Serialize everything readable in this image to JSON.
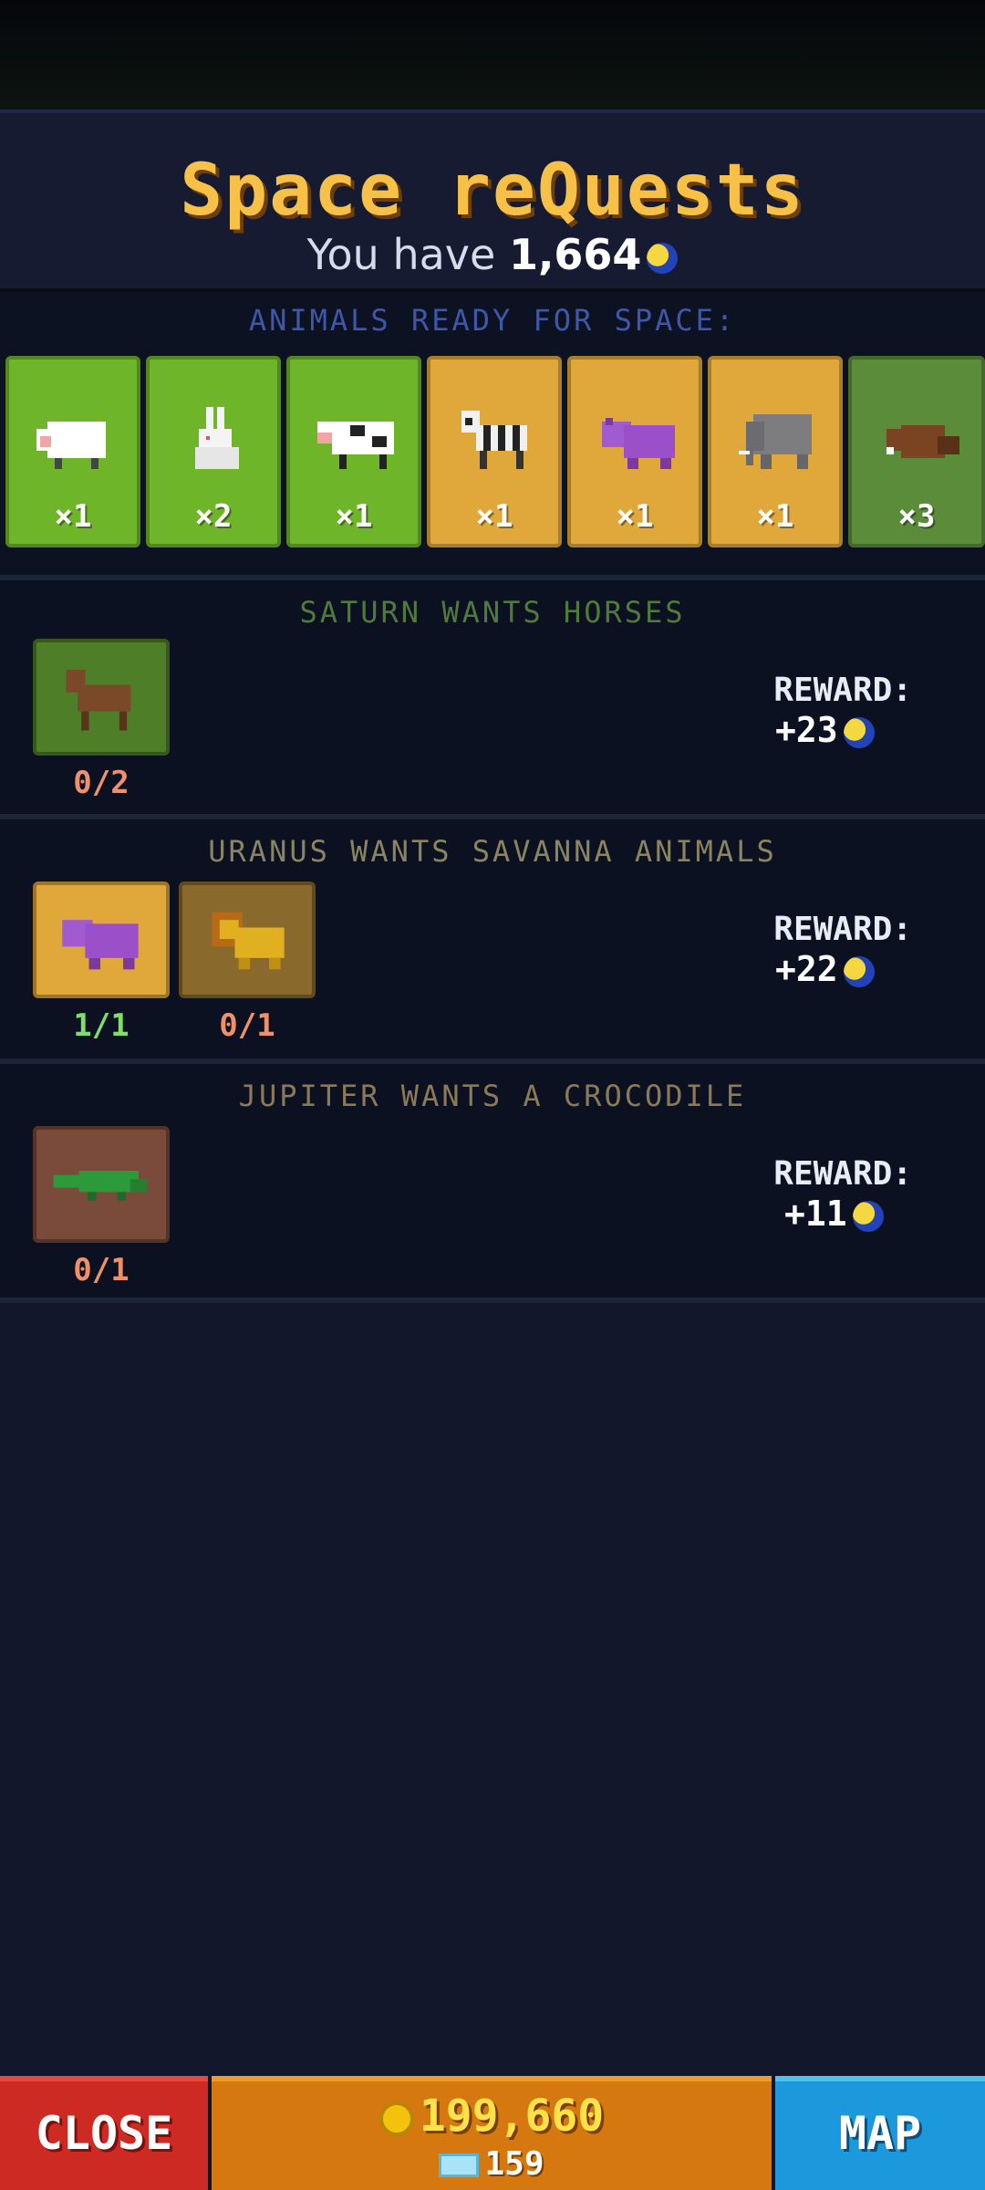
{
  "header": {
    "title": "Space reQuests",
    "have_prefix": "You have",
    "have_amount": "1,664",
    "currency_icon": "moon-coin-icon"
  },
  "ready": {
    "title": "ANIMALS READY FOR SPACE:",
    "animals": [
      {
        "name": "sheep",
        "count": "×1",
        "bg": "green"
      },
      {
        "name": "rabbit",
        "count": "×2",
        "bg": "green"
      },
      {
        "name": "cow",
        "count": "×1",
        "bg": "green"
      },
      {
        "name": "zebra",
        "count": "×1",
        "bg": "sand"
      },
      {
        "name": "hippo",
        "count": "×1",
        "bg": "sand"
      },
      {
        "name": "elephant",
        "count": "×1",
        "bg": "sand"
      },
      {
        "name": "beaver",
        "count": "×3",
        "bg": "dgreen"
      }
    ]
  },
  "quests": [
    {
      "title": "SATURN WANTS HORSES",
      "title_color": "#4f7a3c",
      "reward_label": "REWARD:",
      "reward_value": "+23",
      "items": [
        {
          "animal": "horse",
          "progress": "0/2",
          "progress_color": "#f0906a"
        }
      ]
    },
    {
      "title": "URANUS WANTS SAVANNA ANIMALS",
      "title_color": "#8a8560",
      "reward_label": "REWARD:",
      "reward_value": "+22",
      "items": [
        {
          "animal": "hippo",
          "progress": "1/1",
          "progress_color": "#7ee06a"
        },
        {
          "animal": "lion",
          "progress": "0/1",
          "progress_color": "#f0906a"
        }
      ]
    },
    {
      "title": "JUPITER WANTS A CROCODILE",
      "title_color": "#8a7a58",
      "reward_label": "REWARD:",
      "reward_value": "+11",
      "items": [
        {
          "animal": "crocodile",
          "progress": "0/1",
          "progress_color": "#f0906a"
        }
      ]
    }
  ],
  "footer": {
    "close_label": "CLOSE",
    "coins": "199,660",
    "gems": "159",
    "map_label": "MAP"
  }
}
